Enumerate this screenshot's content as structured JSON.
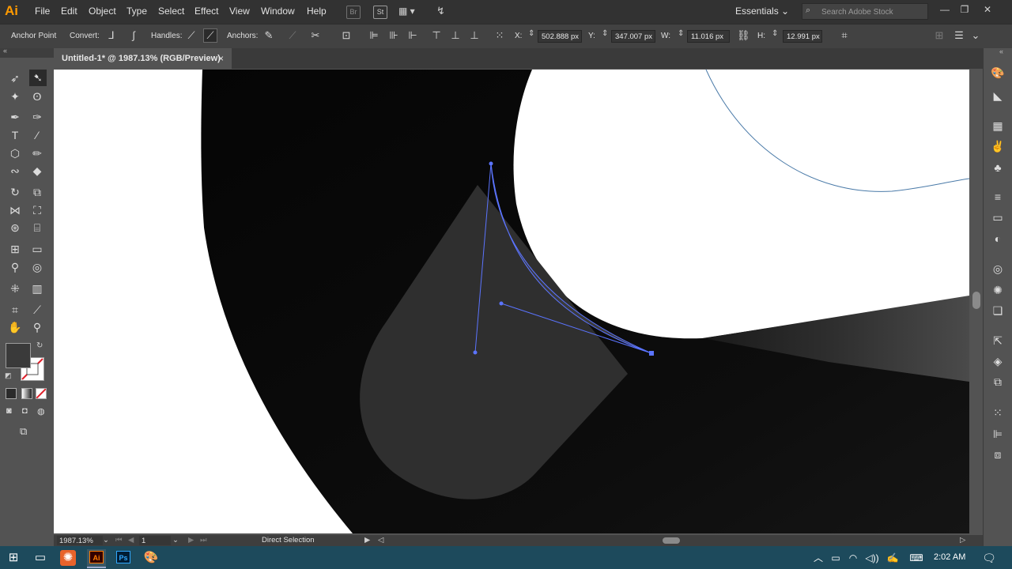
{
  "app": {
    "logo": "Ai"
  },
  "menu": [
    "File",
    "Edit",
    "Object",
    "Type",
    "Select",
    "Effect",
    "View",
    "Window",
    "Help"
  ],
  "menubar_icons": {
    "bridge": "Br",
    "stock": "St"
  },
  "workspace": {
    "label": "Essentials"
  },
  "search": {
    "placeholder": "Search Adobe Stock"
  },
  "control_bar": {
    "tool_label": "Anchor Point",
    "convert_label": "Convert:",
    "handles_label": "Handles:",
    "anchors_label": "Anchors:",
    "x_label": "X:",
    "x_value": "502.888 px",
    "y_label": "Y:",
    "y_value": "347.007 px",
    "w_label": "W:",
    "w_value": "11.016 px",
    "h_label": "H:",
    "h_value": "12.991 px"
  },
  "document": {
    "tab_title": "Untitled-1* @ 1987.13% (RGB/Preview)",
    "close_glyph": "×"
  },
  "status_bar": {
    "zoom": "1987.13%",
    "artboard": "1",
    "current_tool": "Direct Selection"
  },
  "taskbar": {
    "time": "2:02 AM",
    "apps": [
      "Ai",
      "Ps"
    ]
  },
  "colors": {
    "fill": "#3a3a3a",
    "path_selection": "#4a6cff",
    "ai_brand": "#ff9a00",
    "taskbar": "#1d4a5c"
  }
}
